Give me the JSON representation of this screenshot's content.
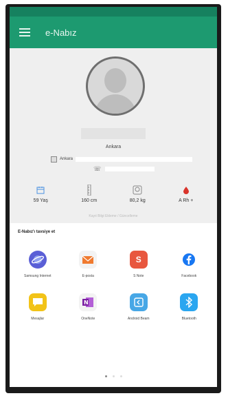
{
  "appbar": {
    "title": "e-Nabız",
    "menu_icon": "hamburger-menu-icon"
  },
  "profile": {
    "city": "Ankara",
    "address_label": "Ankara",
    "stats": [
      {
        "icon": "calendar-icon",
        "value": "59 Yaş"
      },
      {
        "icon": "height-ruler-icon",
        "value": "160 cm"
      },
      {
        "icon": "weight-scale-icon",
        "value": "80,2 kg"
      },
      {
        "icon": "blood-drop-icon",
        "value": "A Rh +"
      }
    ],
    "faint_note": "Kayıt Bilgi Ekleme / Güncelleme"
  },
  "share_sheet": {
    "title": "E-Nabız'ı tavsiye et",
    "apps": [
      {
        "label": "Samsung Internet",
        "icon": "samsung-internet-icon",
        "color": "#5a5fd6"
      },
      {
        "label": "E-posta",
        "icon": "email-icon",
        "color": "#f3f3f3"
      },
      {
        "label": "S Note",
        "icon": "s-note-icon",
        "color": "#e8573f"
      },
      {
        "label": "Facebook",
        "icon": "facebook-icon",
        "color": "#ffffff"
      },
      {
        "label": "Mesajlar",
        "icon": "messages-icon",
        "color": "#f2c318"
      },
      {
        "label": "OneNote",
        "icon": "onenote-icon",
        "color": "#f3f3f3"
      },
      {
        "label": "Android Beam",
        "icon": "android-beam-icon",
        "color": "#47a7e6"
      },
      {
        "label": "Bluetooth",
        "icon": "bluetooth-icon",
        "color": "#2aa6f0"
      }
    ],
    "page_dots": 3,
    "active_dot": 0
  },
  "colors": {
    "appbar": "#1d9a70",
    "statusbar": "#16815f",
    "accent_icon": "#4a90e2",
    "blood": "#d9342b"
  }
}
